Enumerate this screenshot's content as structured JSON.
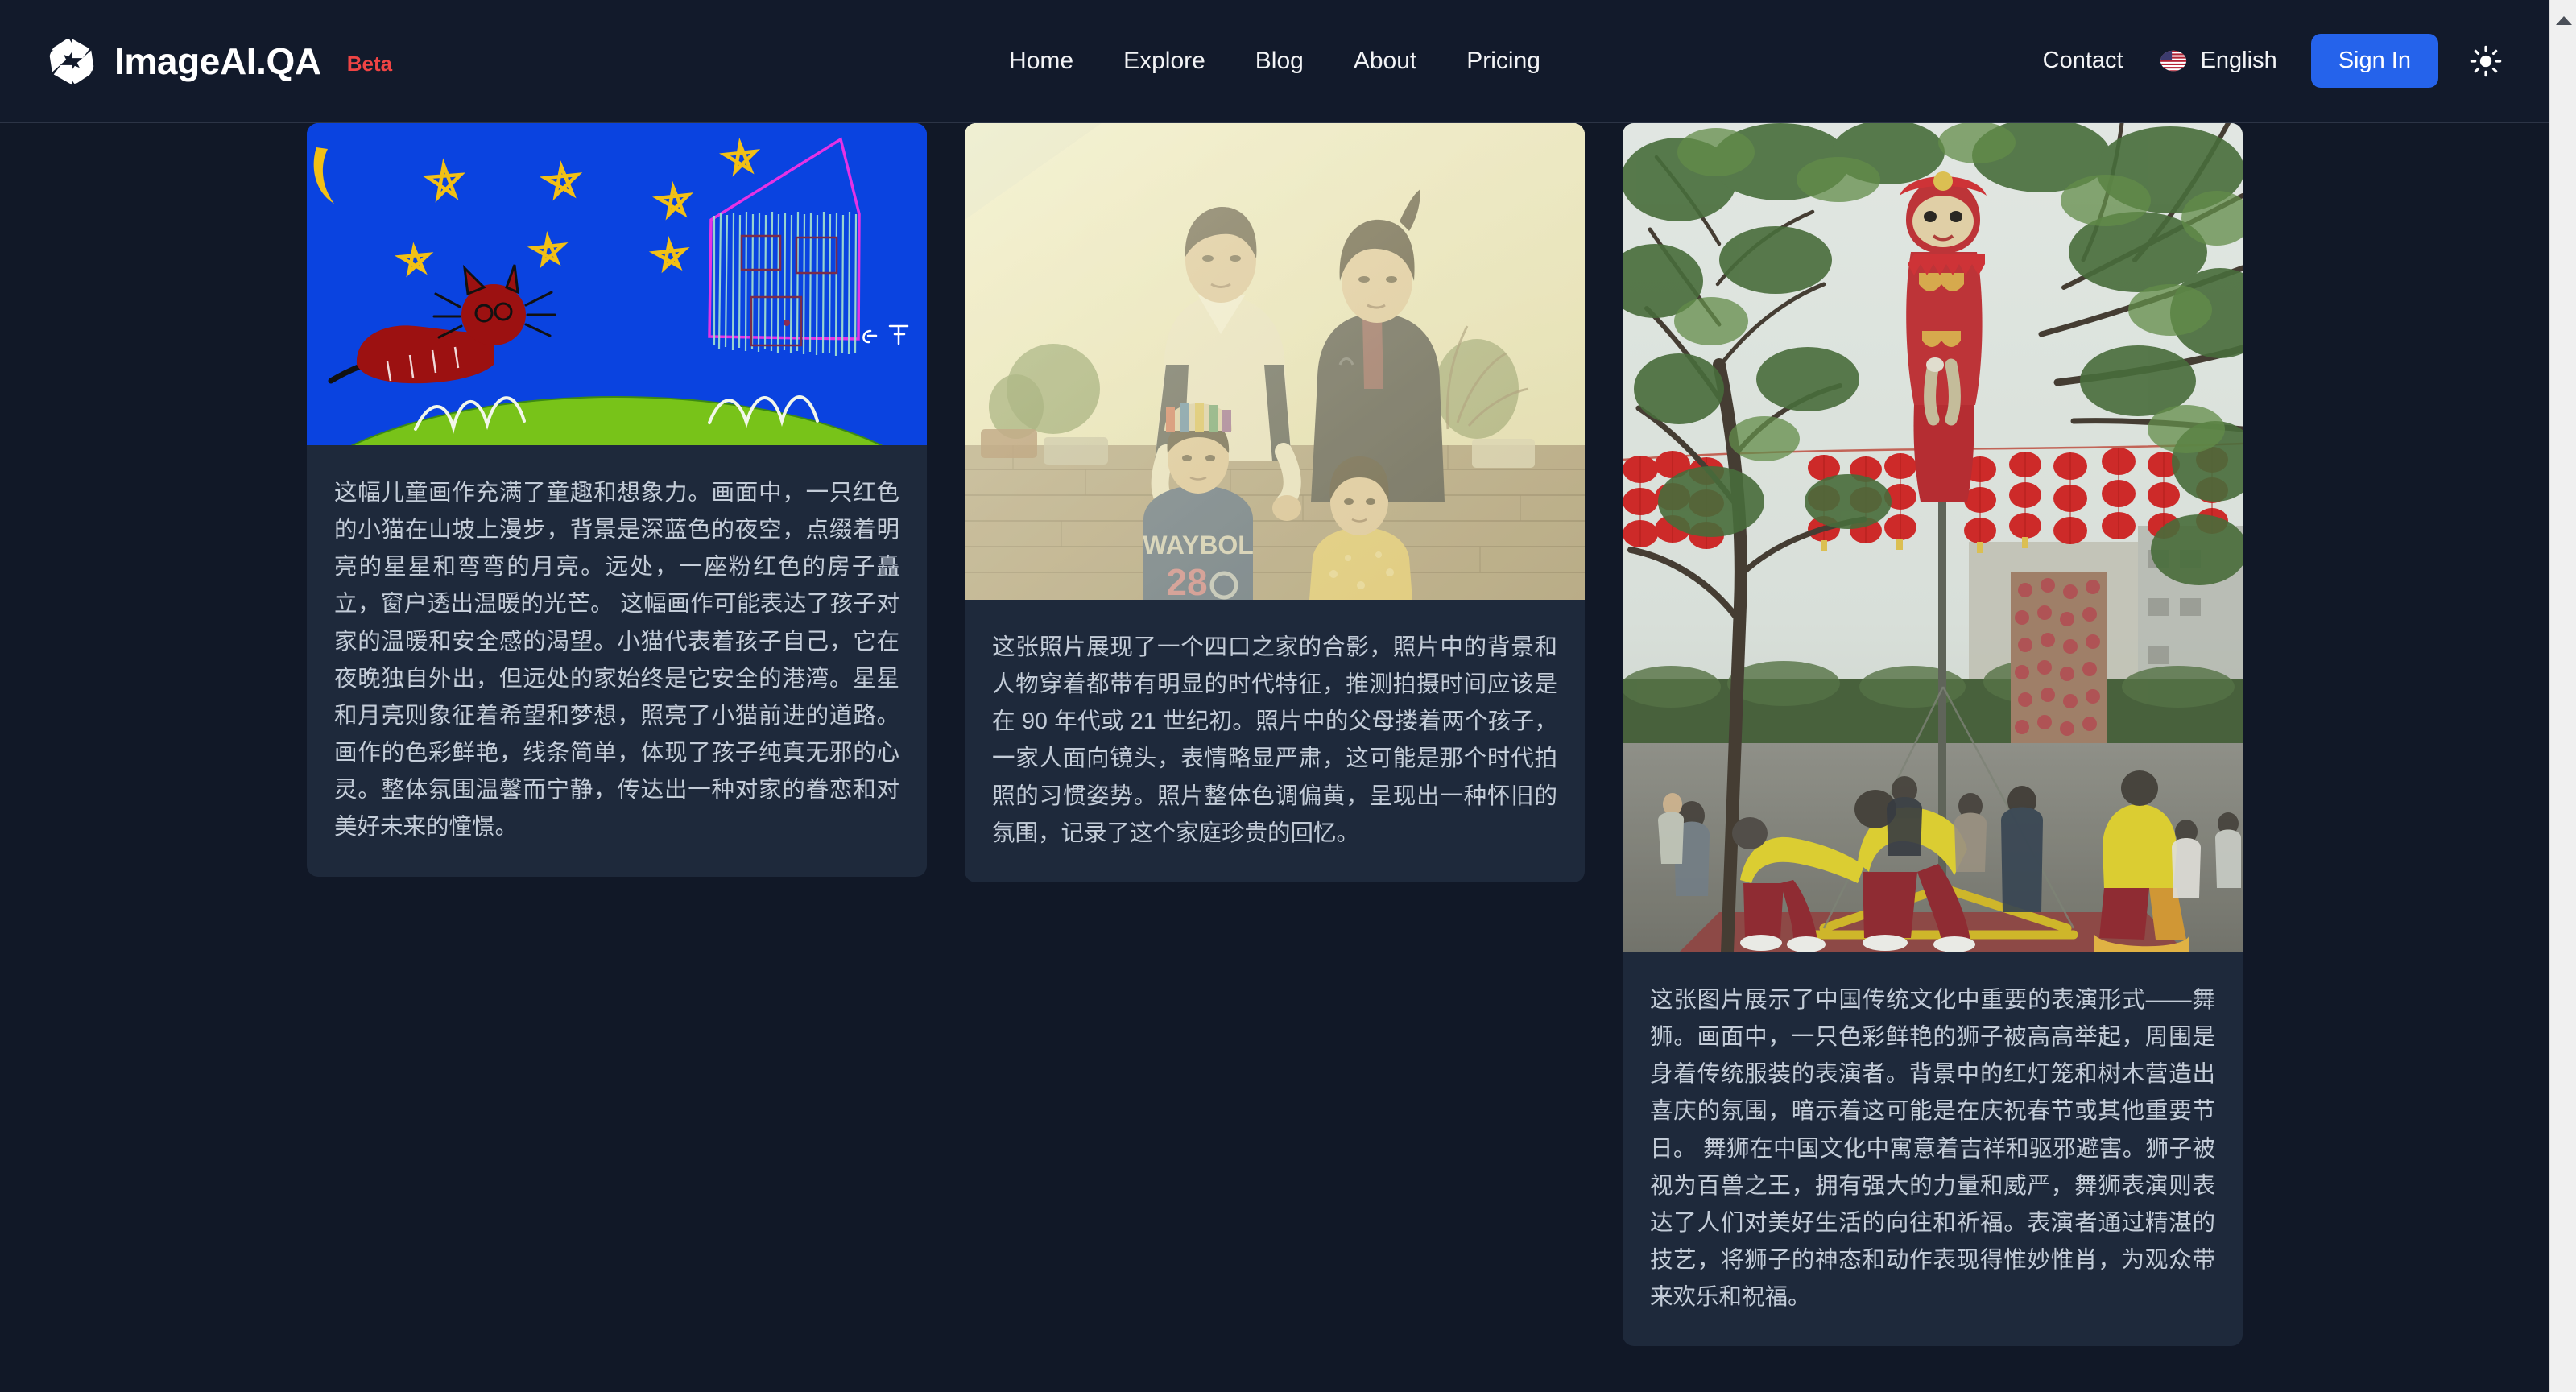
{
  "header": {
    "logo_icon": "aperture-icon",
    "brand_name": "ImageAI.QA",
    "beta_label": "Beta",
    "nav": [
      {
        "label": "Home"
      },
      {
        "label": "Explore"
      },
      {
        "label": "Blog"
      },
      {
        "label": "About"
      },
      {
        "label": "Pricing"
      }
    ],
    "contact_label": "Contact",
    "language": {
      "flag_icon": "us-flag-icon",
      "label": "English"
    },
    "sign_in_label": "Sign In",
    "theme_toggle_icon": "sun-icon"
  },
  "colors": {
    "page_background": "#111827",
    "header_background": "#121a2b",
    "card_background": "#1e293b",
    "accent_blue": "#2563eb",
    "beta_red": "#ef4444",
    "body_text": "#c3ccd8",
    "nav_text": "#f3f4f6"
  },
  "gallery": {
    "cards": [
      {
        "image_name": "childrens-crayon-drawing-cat-on-hill",
        "description": "这幅儿童画作充满了童趣和想象力。画面中，一只红色的小猫在山坡上漫步，背景是深蓝色的夜空，点缀着明亮的星星和弯弯的月亮。远处，一座粉红色的房子矗立，窗户透出温暖的光芒。 这幅画作可能表达了孩子对家的温暖和安全感的渴望。小猫代表着孩子自己，它在夜晚独自外出，但远处的家始终是它安全的港湾。星星和月亮则象征着希望和梦想，照亮了小猫前进的道路。 画作的色彩鲜艳，线条简单，体现了孩子纯真无邪的心灵。整体氛围温馨而宁静，传达出一种对家的眷恋和对美好未来的憧憬。"
      },
      {
        "image_name": "vintage-family-of-four-portrait",
        "description": "这张照片展现了一个四口之家的合影，照片中的背景和人物穿着都带有明显的时代特征，推测拍摄时间应该是在 90 年代或 21 世纪初。照片中的父母搂着两个孩子，一家人面向镜头，表情略显严肃，这可能是那个时代拍照的习惯姿势。照片整体色调偏黄，呈现出一种怀旧的氛围，记录了这个家庭珍贵的回忆。"
      },
      {
        "image_name": "chinese-lion-dance-performance",
        "description": "这张图片展示了中国传统文化中重要的表演形式——舞狮。画面中，一只色彩鲜艳的狮子被高高举起，周围是身着传统服装的表演者。背景中的红灯笼和树木营造出喜庆的氛围，暗示着这可能是在庆祝春节或其他重要节日。 舞狮在中国文化中寓意着吉祥和驱邪避害。狮子被视为百兽之王，拥有强大的力量和威严，舞狮表演则表达了人们对美好生活的向往和祈福。表演者通过精湛的技艺，将狮子的神态和动作表现得惟妙惟肖，为观众带来欢乐和祝福。"
      }
    ]
  },
  "scrollbar": {
    "up_arrow_icon": "triangle-up-icon"
  }
}
